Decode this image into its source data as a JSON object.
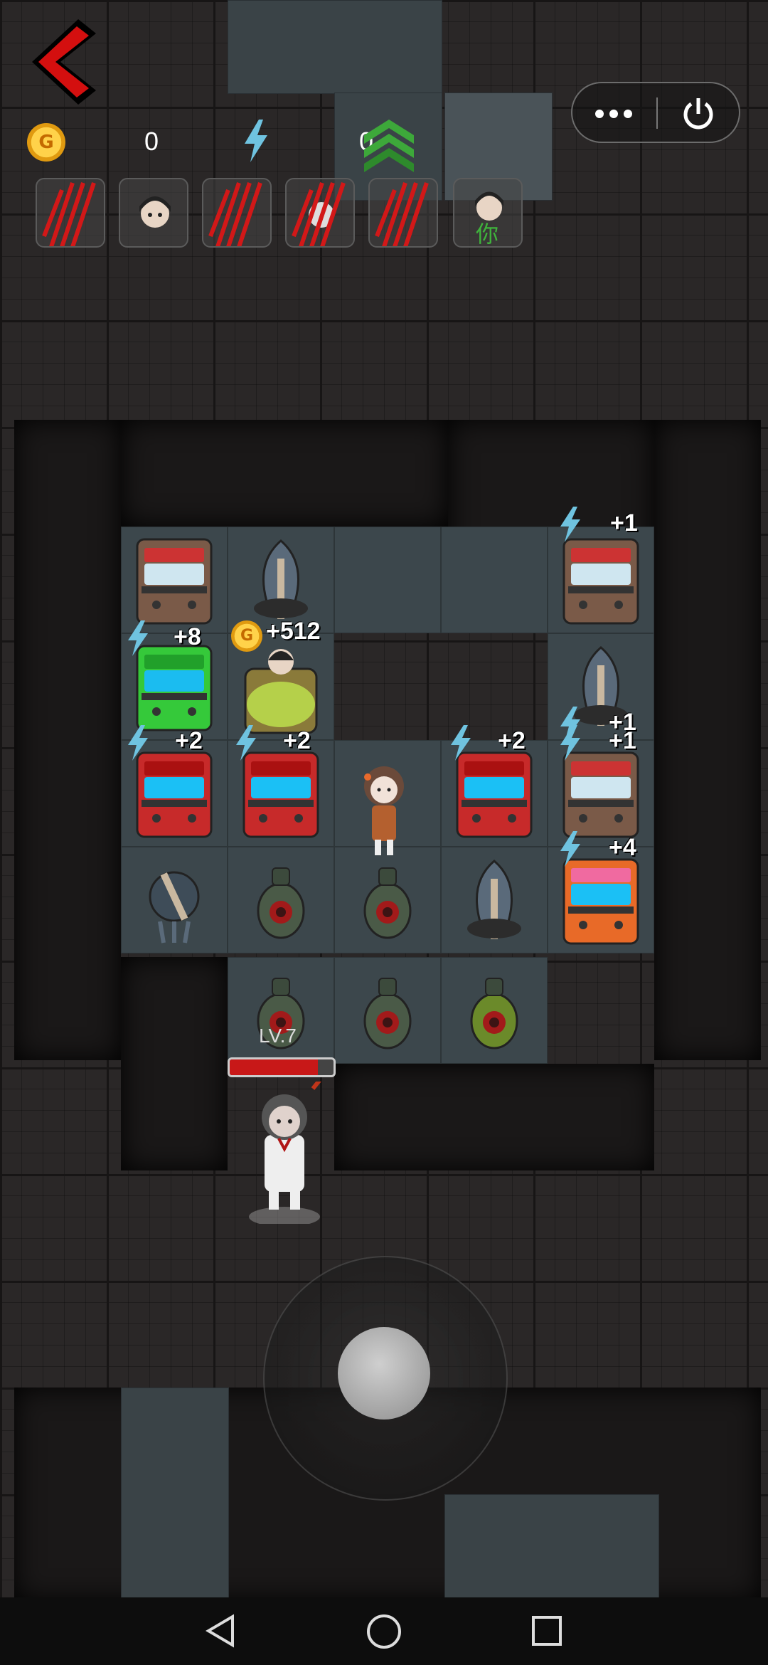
{
  "hud": {
    "coin_glyph": "G",
    "coins": "0",
    "energy": "0",
    "players": [
      {
        "type": "slashed"
      },
      {
        "type": "girl"
      },
      {
        "type": "slashed"
      },
      {
        "type": "slashed"
      },
      {
        "type": "slashed"
      },
      {
        "type": "self",
        "tag": "你"
      }
    ]
  },
  "grid": {
    "bonuses": [
      {
        "id": "b1",
        "text": "+1",
        "has_bolt": true
      },
      {
        "id": "b2",
        "text": "+8",
        "has_bolt": true
      },
      {
        "id": "b3",
        "text": "+512",
        "has_coin": true
      },
      {
        "id": "b4",
        "text": "+1",
        "has_bolt": true
      },
      {
        "id": "b5",
        "text": "+2",
        "has_bolt": true
      },
      {
        "id": "b6",
        "text": "+2",
        "has_bolt": true
      },
      {
        "id": "b7",
        "text": "+2",
        "has_bolt": true
      },
      {
        "id": "b8",
        "text": "+1",
        "has_bolt": true
      },
      {
        "id": "b9",
        "text": "+4",
        "has_bolt": true
      }
    ]
  },
  "player": {
    "level": "LV.7",
    "hp_fraction": 0.85
  },
  "icons": {
    "back": "back-arrow-icon",
    "more": "more-options-icon",
    "power": "power-icon",
    "bolt": "lightning-bolt-icon",
    "rank": "rank-up-chevron-icon",
    "coin": "gold-coin-icon"
  },
  "colors": {
    "accent_red": "#d40f0f",
    "bolt_blue": "#6fc3e0",
    "rank_green": "#3da83a"
  }
}
